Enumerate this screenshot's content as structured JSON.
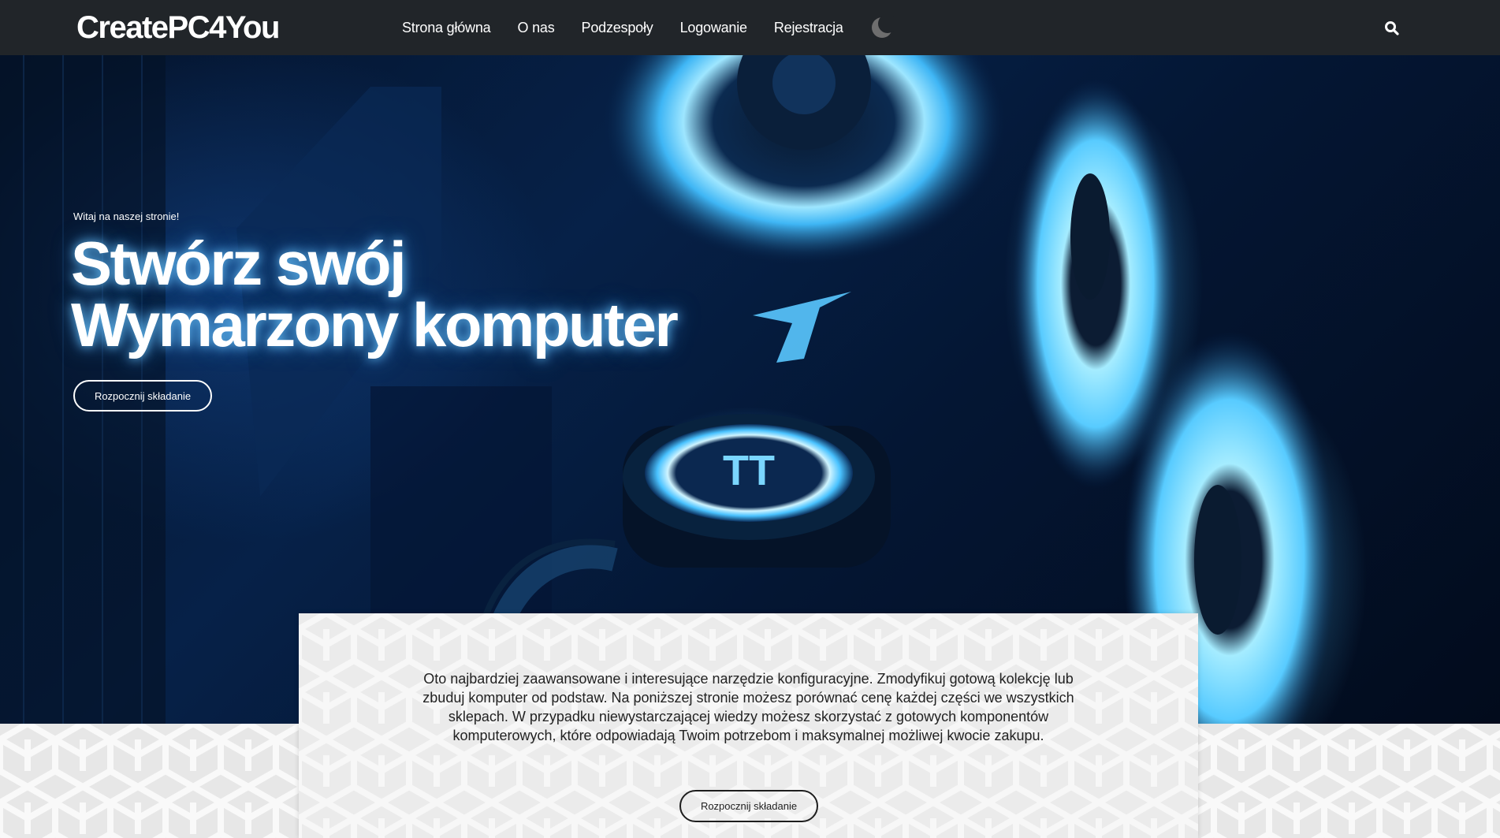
{
  "navbar": {
    "brand": "CreatePC4You",
    "links": [
      "Strona główna",
      "O nas",
      "Podzespoły",
      "Logowanie",
      "Rejestracja"
    ],
    "theme_toggle_icon": "moon-icon",
    "search_icon": "search-icon"
  },
  "hero": {
    "welcome": "Witaj na naszej stronie!",
    "title_line1": "Stwórz swój",
    "title_line2": "Wymarzony komputer",
    "button_label": "Rozpocznij składanie"
  },
  "card": {
    "text": "Oto najbardziej zaawansowane i interesujące narzędzie konfiguracyjne. Zmodyfikuj gotową kolekcję lub zbuduj komputer od podstaw. Na poniższej stronie możesz porównać cenę każdej części we wszystkich sklepach. W przypadku niewystarczającej wiedzy możesz skorzystać z gotowych komponentów komputerowych, które odpowiadają Twoim potrzebom i maksymalnej możliwej kwocie zakupu.",
    "button_label": "Rozpocznij składanie"
  },
  "colors": {
    "navbar_bg": "#212529",
    "hero_glow": "#5ac8ff",
    "pattern_bg": "#e7e7e7"
  }
}
